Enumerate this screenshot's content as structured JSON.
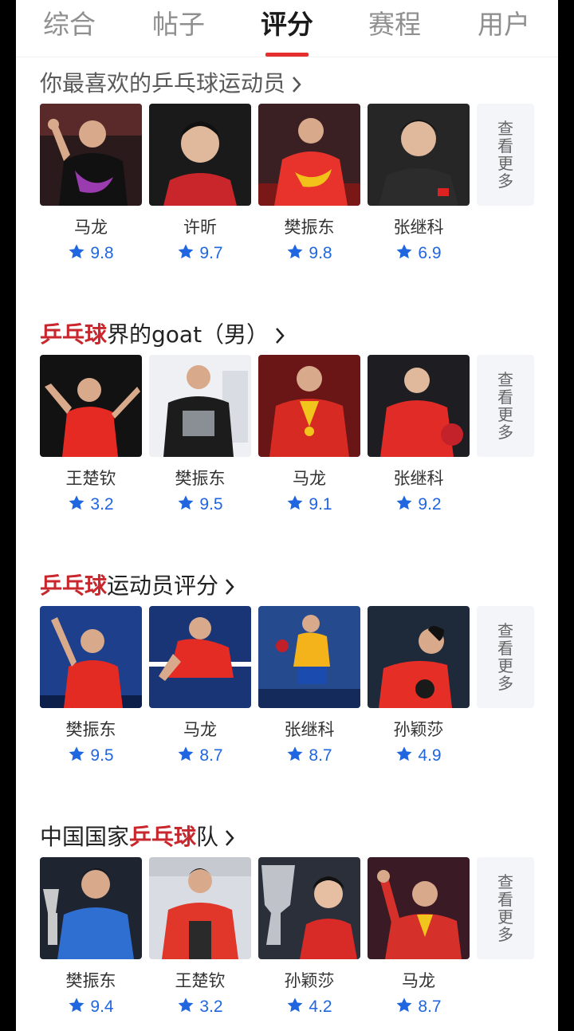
{
  "tabs": [
    "综合",
    "帖子",
    "评分",
    "赛程",
    "用户"
  ],
  "more_label": "查看更多",
  "accent_color": "#e52f2f",
  "rating_color": "#1f66e0",
  "sections": [
    {
      "title_red": "",
      "title_rest": "你最喜欢的乒乓球运动员",
      "title_after": "",
      "cards": [
        {
          "name": "马龙",
          "score": "9.8"
        },
        {
          "name": "许昕",
          "score": "9.7"
        },
        {
          "name": "樊振东",
          "score": "9.8"
        },
        {
          "name": "张继科",
          "score": "6.9"
        }
      ]
    },
    {
      "title_red": "乒乓球",
      "title_rest": "界的goat（男）",
      "title_after": "",
      "cards": [
        {
          "name": "王楚钦",
          "score": "3.2"
        },
        {
          "name": "樊振东",
          "score": "9.5"
        },
        {
          "name": "马龙",
          "score": "9.1"
        },
        {
          "name": "张继科",
          "score": "9.2"
        }
      ]
    },
    {
      "title_red": "乒乓球",
      "title_rest": "运动员评分",
      "title_after": "",
      "cards": [
        {
          "name": "樊振东",
          "score": "9.5"
        },
        {
          "name": "马龙",
          "score": "8.7"
        },
        {
          "name": "张继科",
          "score": "8.7"
        },
        {
          "name": "孙颖莎",
          "score": "4.9"
        }
      ]
    },
    {
      "title_pre": "中国国家",
      "title_red": "乒乓球",
      "title_rest": "",
      "title_after": "队",
      "cards": [
        {
          "name": "樊振东",
          "score": "9.4"
        },
        {
          "name": "王楚钦",
          "score": "3.2"
        },
        {
          "name": "孙颖莎",
          "score": "4.2"
        },
        {
          "name": "马龙",
          "score": "8.7"
        }
      ]
    }
  ]
}
